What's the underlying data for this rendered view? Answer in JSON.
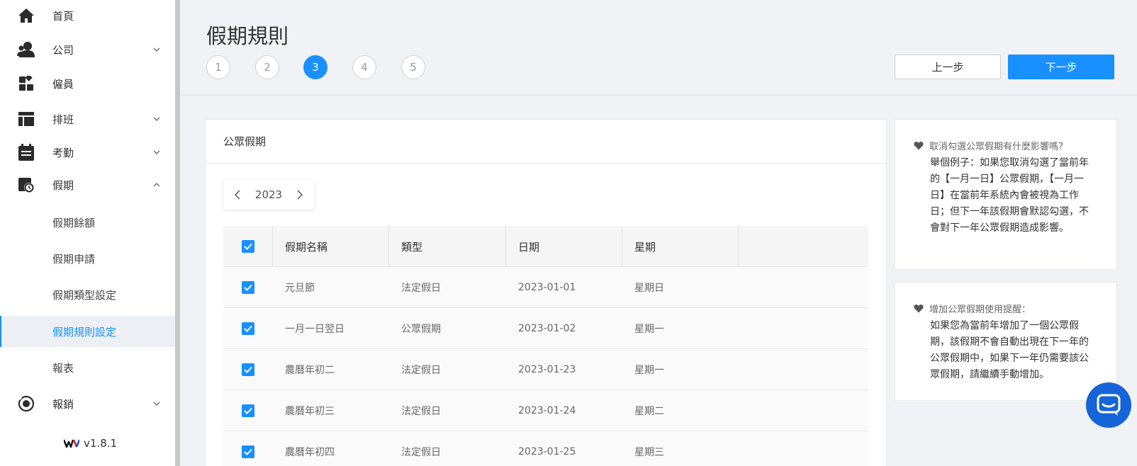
{
  "sidebar": {
    "items": [
      {
        "label": "首頁",
        "icon": "home-icon",
        "expandable": false
      },
      {
        "label": "公司",
        "icon": "user-icon",
        "expandable": true,
        "expanded": false
      },
      {
        "label": "僱員",
        "icon": "grid-icon",
        "expandable": false
      },
      {
        "label": "排班",
        "icon": "layout-icon",
        "expandable": true,
        "expanded": false
      },
      {
        "label": "考勤",
        "icon": "calendar-icon",
        "expandable": true,
        "expanded": false
      },
      {
        "label": "假期",
        "icon": "holiday-clock-icon",
        "expandable": true,
        "expanded": true
      },
      {
        "label": "報銷",
        "icon": "reimburse-icon",
        "expandable": true,
        "expanded": false
      }
    ],
    "subitems": [
      {
        "label": "假期餘額"
      },
      {
        "label": "假期申請"
      },
      {
        "label": "假期類型設定"
      },
      {
        "label": "假期規則設定",
        "active": true
      },
      {
        "label": "報表"
      }
    ],
    "version": "v1.8.1"
  },
  "header": {
    "title": "假期規則",
    "steps": [
      "1",
      "2",
      "3",
      "4",
      "5"
    ],
    "active_step": 3,
    "prev_label": "上一步",
    "next_label": "下一步"
  },
  "card": {
    "title": "公眾假期",
    "year": "2023",
    "table": {
      "columns": [
        "假期名稱",
        "類型",
        "日期",
        "星期"
      ],
      "rows": [
        {
          "name": "元旦節",
          "type": "法定假日",
          "date": "2023-01-01",
          "weekday": "星期日",
          "checked": true
        },
        {
          "name": "一月一日翌日",
          "type": "公眾假期",
          "date": "2023-01-02",
          "weekday": "星期一",
          "checked": true
        },
        {
          "name": "農曆年初二",
          "type": "法定假日",
          "date": "2023-01-23",
          "weekday": "星期一",
          "checked": true
        },
        {
          "name": "農曆年初三",
          "type": "法定假日",
          "date": "2023-01-24",
          "weekday": "星期二",
          "checked": true
        },
        {
          "name": "農曆年初四",
          "type": "法定假日",
          "date": "2023-01-25",
          "weekday": "星期三",
          "checked": true
        }
      ]
    }
  },
  "tips": [
    {
      "heading": "取消勾選公眾假期有什麼影響嗎?",
      "body": "舉個例子：如果您取消勾選了當前年的【一月一日】公眾假期，【一月一日】在當前年系統內會被視為工作日；但下一年該假期會默認勾選，不會對下一年公眾假期造成影響。"
    },
    {
      "heading": "增加公眾假期使用提醒：",
      "body": "如果您為當前年增加了一個公眾假期，該假期不會自動出現在下一年的公眾假期中，如果下一年仍需要該公眾假期，請繼續手動增加。"
    }
  ],
  "colors": {
    "accent": "#1890ff",
    "chat": "#1565d8"
  }
}
